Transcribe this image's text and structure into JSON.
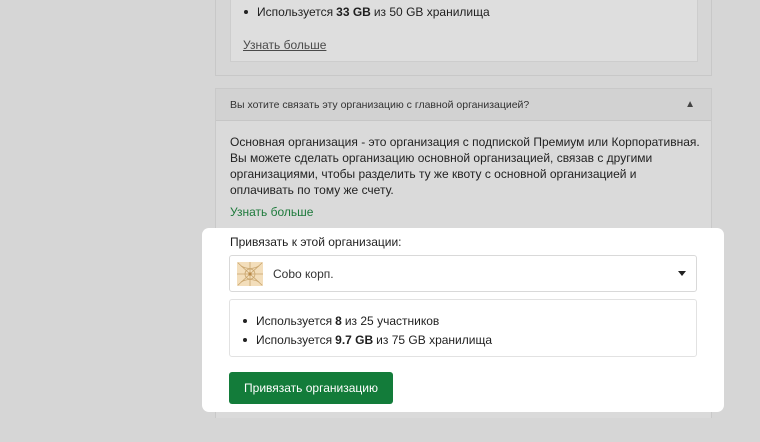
{
  "top_card": {
    "usage_prefix": "Используется",
    "usage_value": "33 GB",
    "usage_suffix": "из 50 GB хранилища",
    "learn_more": "Узнать больше"
  },
  "question_panel": {
    "question": "Вы хотите связать эту организацию с главной организацией?",
    "description": "Основная организация - это организация с подпиской Премиум или Корпоративная. Вы можете сделать организацию основной организацией, связав с другими организациями, чтобы разделить ту же квоту с основной организацией и оплачивать по тому же счету.",
    "learn_more": "Узнать больше"
  },
  "link_section": {
    "label": "Привязать к этой организации:",
    "selected_org": "Cobo корп.",
    "members_prefix": "Используется",
    "members_value": "8",
    "members_suffix": "из 25 участников",
    "storage_prefix": "Используется",
    "storage_value": "9.7 GB",
    "storage_suffix": "из 75 GB хранилища",
    "button_label": "Привязать организацию"
  },
  "icons": {
    "collapse": "chevron-up-icon",
    "dropdown": "caret-down-icon",
    "org_logo": "org-logo"
  },
  "colors": {
    "accent_green": "#137c3a",
    "link_green": "#1e7a3c"
  }
}
